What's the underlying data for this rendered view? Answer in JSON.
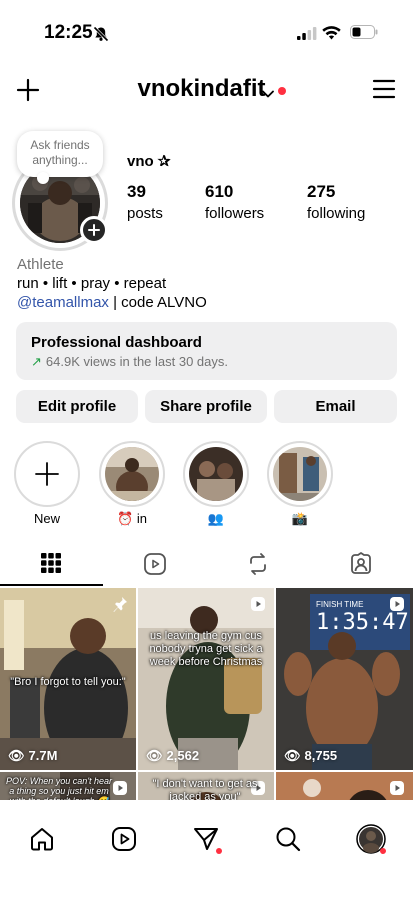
{
  "status_bar": {
    "time": "12:25"
  },
  "header": {
    "username": "vnokindafit"
  },
  "profile": {
    "note_text": "Ask friends anything...",
    "display_name": "vno ✰",
    "stats": [
      {
        "value": "39",
        "label": "posts"
      },
      {
        "value": "610",
        "label": "followers"
      },
      {
        "value": "275",
        "label": "following"
      }
    ],
    "category": "Athlete",
    "bio_line": "run • lift • pray • repeat",
    "bio_mention": "@teamallmax",
    "bio_code": " | code ALVNO"
  },
  "dashboard": {
    "title": "Professional dashboard",
    "subtitle": "64.9K views in the last 30 days."
  },
  "buttons": {
    "edit": "Edit profile",
    "share": "Share profile",
    "email": "Email"
  },
  "highlights": [
    {
      "label": "New"
    },
    {
      "label": "⏰ in"
    },
    {
      "label": "👥"
    },
    {
      "label": "📸"
    }
  ],
  "grid": [
    {
      "caption": "\"Bro I forgot to tell you:\"",
      "views": "7.7M"
    },
    {
      "caption": "us leaving the gym cus nobody tryna get sick a week before Christmas",
      "views": "2,562"
    },
    {
      "caption": "FINISH TIME",
      "timer": "1:35:47",
      "views": "8,755"
    },
    {
      "caption": "POV: When you can't hear a thing so you just hit em with the default laugh 😅"
    },
    {
      "caption": "\"I don't want to get as jacked as you\""
    },
    {
      "caption": ""
    }
  ]
}
